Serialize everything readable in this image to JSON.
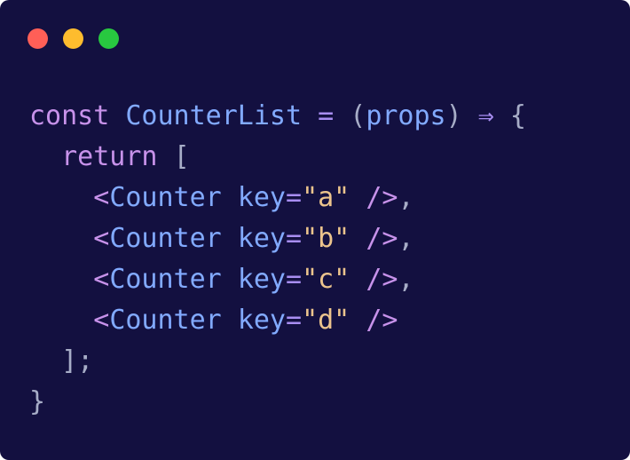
{
  "window": {
    "controls": {
      "close_color": "#ff5f57",
      "minimize_color": "#febc2e",
      "zoom_color": "#28c840"
    }
  },
  "code": {
    "language": "javascript (jsx)",
    "lines": [
      {
        "indent": "",
        "tokens": [
          {
            "text": "const",
            "type": "kw"
          },
          {
            "text": " ",
            "type": "pun"
          },
          {
            "text": "CounterList",
            "type": "fn"
          },
          {
            "text": " ",
            "type": "pun"
          },
          {
            "text": "=",
            "type": "op"
          },
          {
            "text": " ",
            "type": "pun"
          },
          {
            "text": "(",
            "type": "pun"
          },
          {
            "text": "props",
            "type": "fn"
          },
          {
            "text": ")",
            "type": "pun"
          },
          {
            "text": " ",
            "type": "pun"
          },
          {
            "text": "⇒",
            "type": "op"
          },
          {
            "text": " ",
            "type": "pun"
          },
          {
            "text": "{",
            "type": "pun"
          }
        ]
      },
      {
        "indent": "  ",
        "tokens": [
          {
            "text": "return",
            "type": "kw"
          },
          {
            "text": " ",
            "type": "pun"
          },
          {
            "text": "[",
            "type": "pun"
          }
        ]
      },
      {
        "indent": "    ",
        "tokens": [
          {
            "text": "<",
            "type": "tag"
          },
          {
            "text": "Counter",
            "type": "comp"
          },
          {
            "text": " ",
            "type": "pun"
          },
          {
            "text": "key",
            "type": "attr"
          },
          {
            "text": "=",
            "type": "op"
          },
          {
            "text": "\"a\"",
            "type": "str"
          },
          {
            "text": " ",
            "type": "pun"
          },
          {
            "text": "/>",
            "type": "tag"
          },
          {
            "text": ",",
            "type": "pun"
          }
        ]
      },
      {
        "indent": "    ",
        "tokens": [
          {
            "text": "<",
            "type": "tag"
          },
          {
            "text": "Counter",
            "type": "comp"
          },
          {
            "text": " ",
            "type": "pun"
          },
          {
            "text": "key",
            "type": "attr"
          },
          {
            "text": "=",
            "type": "op"
          },
          {
            "text": "\"b\"",
            "type": "str"
          },
          {
            "text": " ",
            "type": "pun"
          },
          {
            "text": "/>",
            "type": "tag"
          },
          {
            "text": ",",
            "type": "pun"
          }
        ]
      },
      {
        "indent": "    ",
        "tokens": [
          {
            "text": "<",
            "type": "tag"
          },
          {
            "text": "Counter",
            "type": "comp"
          },
          {
            "text": " ",
            "type": "pun"
          },
          {
            "text": "key",
            "type": "attr"
          },
          {
            "text": "=",
            "type": "op"
          },
          {
            "text": "\"c\"",
            "type": "str"
          },
          {
            "text": " ",
            "type": "pun"
          },
          {
            "text": "/>",
            "type": "tag"
          },
          {
            "text": ",",
            "type": "pun"
          }
        ]
      },
      {
        "indent": "    ",
        "tokens": [
          {
            "text": "<",
            "type": "tag"
          },
          {
            "text": "Counter",
            "type": "comp"
          },
          {
            "text": " ",
            "type": "pun"
          },
          {
            "text": "key",
            "type": "attr"
          },
          {
            "text": "=",
            "type": "op"
          },
          {
            "text": "\"d\"",
            "type": "str"
          },
          {
            "text": " ",
            "type": "pun"
          },
          {
            "text": "/>",
            "type": "tag"
          }
        ]
      },
      {
        "indent": "  ",
        "tokens": [
          {
            "text": "];",
            "type": "pun"
          }
        ]
      },
      {
        "indent": "",
        "tokens": [
          {
            "text": "}",
            "type": "pun"
          }
        ]
      }
    ]
  }
}
